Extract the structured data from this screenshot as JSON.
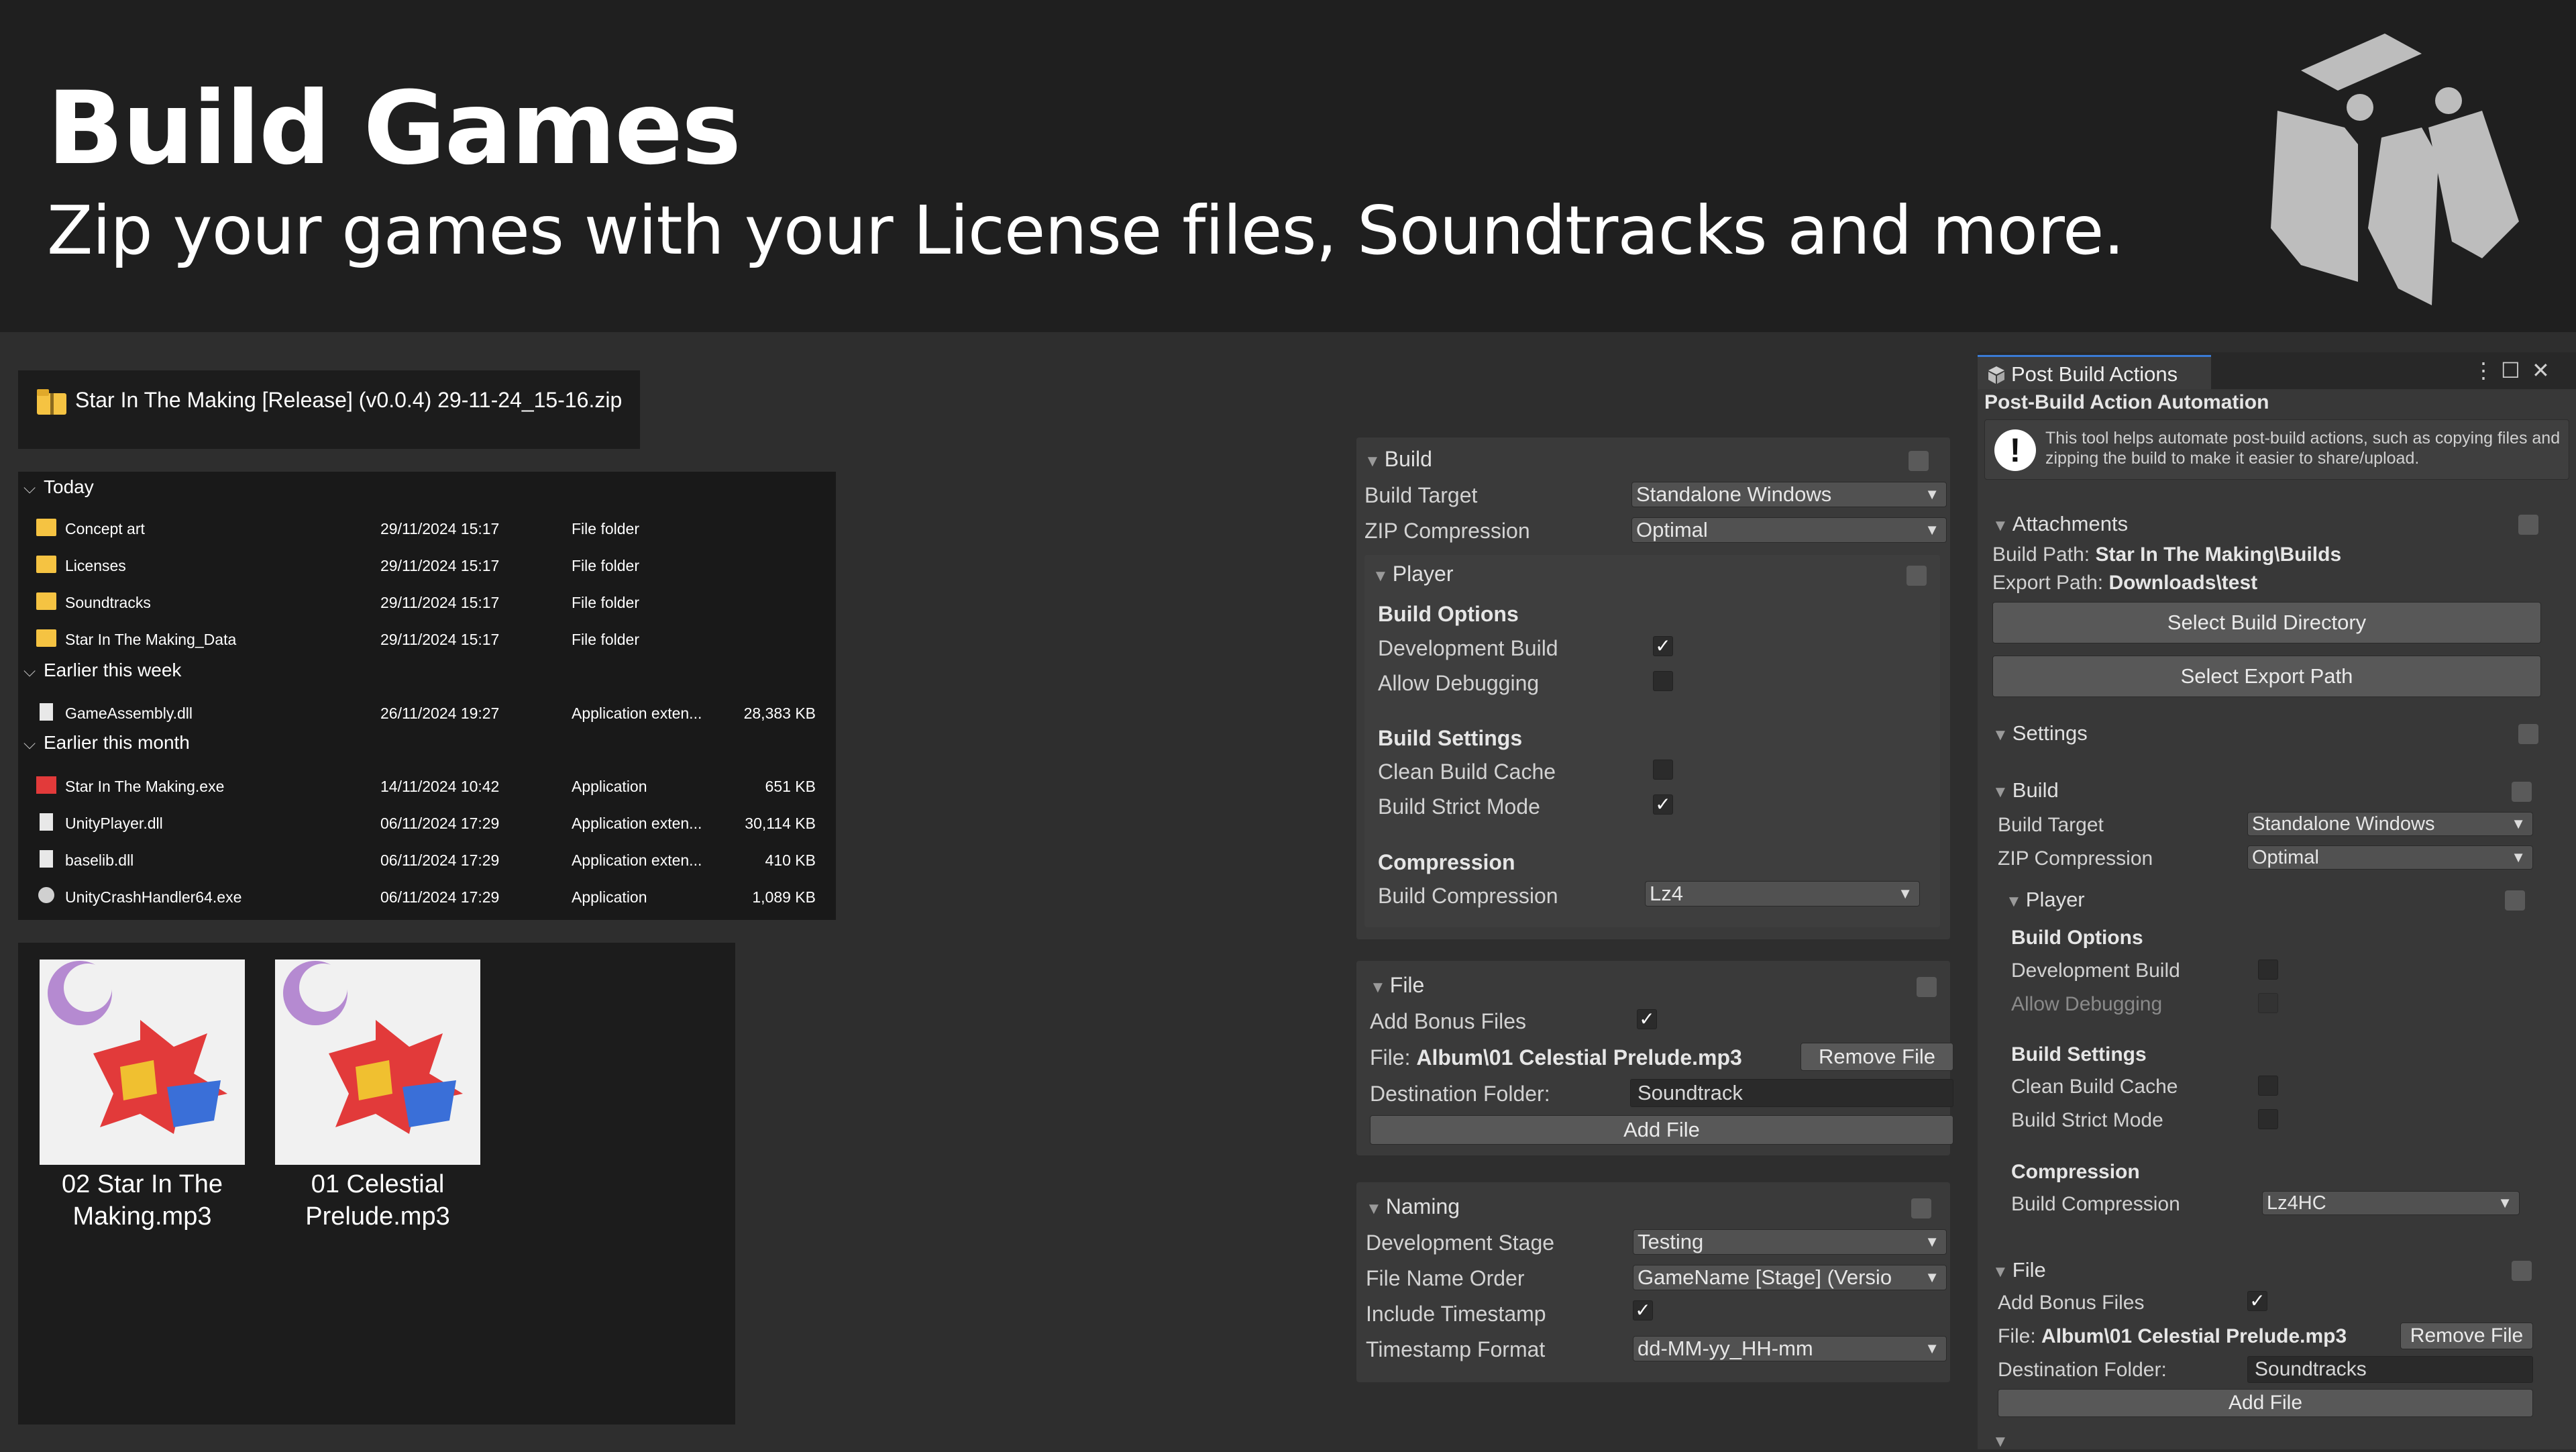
{
  "header": {
    "title": "Build Games",
    "subtitle": "Zip your games with your License files, Soundtracks and more."
  },
  "explorer": {
    "zip_name": "Star In The Making [Release] (v0.0.4) 29-11-24_15-16.zip",
    "groups": [
      "Today",
      "Earlier this week",
      "Earlier this month"
    ],
    "files": [
      {
        "name": "Concept art",
        "date": "29/11/2024 15:17",
        "type": "File folder",
        "size": ""
      },
      {
        "name": "Licenses",
        "date": "29/11/2024 15:17",
        "type": "File folder",
        "size": ""
      },
      {
        "name": "Soundtracks",
        "date": "29/11/2024 15:17",
        "type": "File folder",
        "size": ""
      },
      {
        "name": "Star In The Making_Data",
        "date": "29/11/2024 15:17",
        "type": "File folder",
        "size": ""
      },
      {
        "name": "GameAssembly.dll",
        "date": "26/11/2024 19:27",
        "type": "Application exten...",
        "size": "28,383 KB"
      },
      {
        "name": "Star In The Making.exe",
        "date": "14/11/2024 10:42",
        "type": "Application",
        "size": "651 KB"
      },
      {
        "name": "UnityPlayer.dll",
        "date": "06/11/2024 17:29",
        "type": "Application exten...",
        "size": "30,114 KB"
      },
      {
        "name": "baselib.dll",
        "date": "06/11/2024 17:29",
        "type": "Application exten...",
        "size": "410 KB"
      },
      {
        "name": "UnityCrashHandler64.exe",
        "date": "06/11/2024 17:29",
        "type": "Application",
        "size": "1,089 KB"
      }
    ],
    "tracks": [
      {
        "caption_1": "02 Star In The",
        "caption_2": "Making.mp3"
      },
      {
        "caption_1": "01 Celestial",
        "caption_2": "Prelude.mp3"
      }
    ]
  },
  "middle": {
    "build": {
      "header": "Build",
      "target_label": "Build Target",
      "target_value": "Standalone Windows",
      "zip_label": "ZIP Compression",
      "zip_value": "Optimal"
    },
    "player": {
      "header": "Player",
      "options_title": "Build Options",
      "dev_build": "Development Build",
      "allow_debug": "Allow Debugging",
      "settings_title": "Build Settings",
      "clean_cache": "Clean Build Cache",
      "strict_mode": "Build Strict Mode",
      "compression_title": "Compression",
      "build_compression": "Build Compression",
      "compression_value": "Lz4"
    },
    "file": {
      "header": "File",
      "bonus": "Add Bonus Files",
      "file_prefix": "File:",
      "file_value": "Album\\01 Celestial Prelude.mp3",
      "remove": "Remove File",
      "dest_label": "Destination Folder:",
      "dest_value": "Soundtrack",
      "add": "Add File"
    },
    "naming": {
      "header": "Naming",
      "stage_label": "Development Stage",
      "stage_value": "Testing",
      "order_label": "File Name Order",
      "order_value": "GameName [Stage] (Versio",
      "ts_label": "Include Timestamp",
      "fmt_label": "Timestamp Format",
      "fmt_value": "dd-MM-yy_HH-mm"
    }
  },
  "window": {
    "tab": "Post Build Actions",
    "heading": "Post-Build Action Automation",
    "info": "This tool helps automate post-build actions, such as copying files and zipping the build to make it easier to share/upload.",
    "attachments": {
      "header": "Attachments",
      "build_path_label": "Build Path:",
      "build_path_value": "Star In The Making\\Builds",
      "export_path_label": "Export Path:",
      "export_path_value": "Downloads\\test",
      "select_build": "Select Build Directory",
      "select_export": "Select Export Path"
    },
    "settings_header": "Settings",
    "build": {
      "header": "Build",
      "target_label": "Build Target",
      "target_value": "Standalone Windows",
      "zip_label": "ZIP Compression",
      "zip_value": "Optimal"
    },
    "player": {
      "header": "Player",
      "options_title": "Build Options",
      "dev_build": "Development Build",
      "allow_debug": "Allow Debugging",
      "settings_title": "Build Settings",
      "clean_cache": "Clean Build Cache",
      "strict_mode": "Build Strict Mode",
      "compression_title": "Compression",
      "build_compression": "Build Compression",
      "compression_value": "Lz4HC"
    },
    "file": {
      "header": "File",
      "bonus": "Add Bonus Files",
      "file_prefix": "File:",
      "file_value": "Album\\01 Celestial Prelude.mp3",
      "remove": "Remove File",
      "dest_label": "Destination Folder:",
      "dest_value": "Soundtracks",
      "add": "Add File"
    }
  }
}
